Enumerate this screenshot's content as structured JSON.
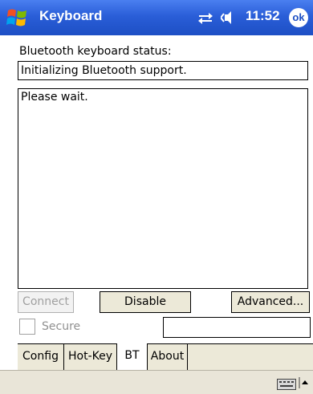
{
  "titlebar": {
    "title": "Keyboard",
    "time": "11:52",
    "ok_label": "ok",
    "icons": [
      "windows-logo",
      "connectivity-icon",
      "speaker-icon"
    ]
  },
  "status": {
    "label": "Bluetooth keyboard status:",
    "value": "Initializing Bluetooth support."
  },
  "log": {
    "text": "Please wait."
  },
  "buttons": {
    "connect": "Connect",
    "disable": "Disable",
    "advanced": "Advanced..."
  },
  "secure": {
    "label": "Secure",
    "checked": false,
    "value": ""
  },
  "tabs": [
    {
      "label": "Config",
      "active": false
    },
    {
      "label": "Hot-Key",
      "active": false
    },
    {
      "label": "BT",
      "active": true
    },
    {
      "label": "About",
      "active": false
    }
  ],
  "menubar": {
    "icons": [
      "keyboard-icon",
      "sip-arrow-icon"
    ]
  },
  "colors": {
    "titlebar": "#2a5ed8",
    "disabled_text": "#a0a0a0",
    "tab_bg": "#ece9d8"
  }
}
